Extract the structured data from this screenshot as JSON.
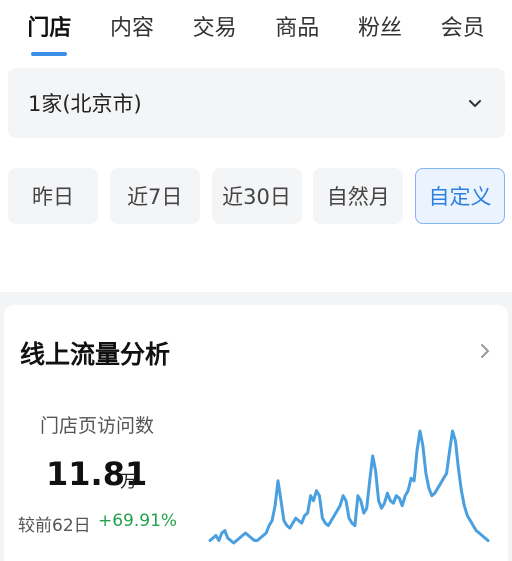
{
  "tabs": [
    {
      "label": "门店",
      "active": true
    },
    {
      "label": "内容",
      "active": false
    },
    {
      "label": "交易",
      "active": false
    },
    {
      "label": "商品",
      "active": false
    },
    {
      "label": "粉丝",
      "active": false
    },
    {
      "label": "会员",
      "active": false
    }
  ],
  "store_selector": {
    "value": "1家(北京市)",
    "icon": "chevron-down-icon"
  },
  "date_ranges": [
    {
      "label": "昨日",
      "selected": false
    },
    {
      "label": "近7日",
      "selected": false
    },
    {
      "label": "近30日",
      "selected": false
    },
    {
      "label": "自然月",
      "selected": false
    },
    {
      "label": "自定义",
      "selected": true
    }
  ],
  "card": {
    "title": "线上流量分析",
    "arrow_icon": "chevron-right-icon",
    "metric_label": "门店页访问数",
    "metric_value": "11.81",
    "metric_unit": "万",
    "compare_label": "较前62日",
    "compare_value": "+69.91%"
  },
  "colors": {
    "accent": "#3b8fe8",
    "positive": "#23a24d",
    "sparkline": "#4a9fe0"
  },
  "chart_data": {
    "type": "line",
    "title": "",
    "xlabel": "",
    "ylabel": "",
    "values": [
      6,
      7,
      8,
      6,
      9,
      10,
      7,
      6,
      5,
      6,
      7,
      8,
      9,
      8,
      7,
      6,
      6,
      7,
      8,
      9,
      12,
      14,
      20,
      30,
      22,
      14,
      12,
      11,
      13,
      15,
      14,
      13,
      16,
      17,
      24,
      22,
      26,
      24,
      15,
      13,
      12,
      14,
      16,
      18,
      20,
      24,
      22,
      15,
      13,
      12,
      24,
      22,
      17,
      19,
      30,
      40,
      34,
      22,
      19,
      21,
      25,
      22,
      21,
      24,
      23,
      20,
      24,
      26,
      31,
      30,
      42,
      50,
      44,
      33,
      27,
      24,
      25,
      27,
      29,
      31,
      33,
      42,
      50,
      46,
      35,
      26,
      20,
      16,
      14,
      12,
      10,
      9,
      8,
      7,
      6
    ]
  }
}
